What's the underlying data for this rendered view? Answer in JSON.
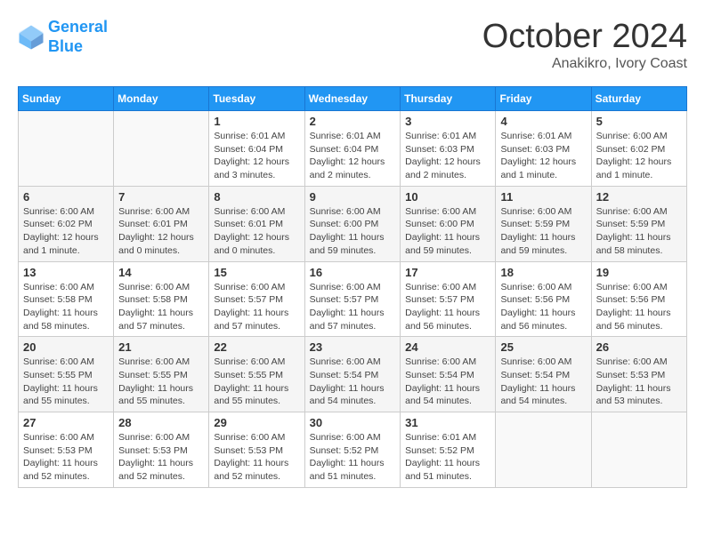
{
  "header": {
    "logo_line1": "General",
    "logo_line2": "Blue",
    "month": "October 2024",
    "location": "Anakikro, Ivory Coast"
  },
  "weekdays": [
    "Sunday",
    "Monday",
    "Tuesday",
    "Wednesday",
    "Thursday",
    "Friday",
    "Saturday"
  ],
  "weeks": [
    [
      {
        "day": "",
        "info": ""
      },
      {
        "day": "",
        "info": ""
      },
      {
        "day": "1",
        "info": "Sunrise: 6:01 AM\nSunset: 6:04 PM\nDaylight: 12 hours and 3 minutes."
      },
      {
        "day": "2",
        "info": "Sunrise: 6:01 AM\nSunset: 6:04 PM\nDaylight: 12 hours and 2 minutes."
      },
      {
        "day": "3",
        "info": "Sunrise: 6:01 AM\nSunset: 6:03 PM\nDaylight: 12 hours and 2 minutes."
      },
      {
        "day": "4",
        "info": "Sunrise: 6:01 AM\nSunset: 6:03 PM\nDaylight: 12 hours and 1 minute."
      },
      {
        "day": "5",
        "info": "Sunrise: 6:00 AM\nSunset: 6:02 PM\nDaylight: 12 hours and 1 minute."
      }
    ],
    [
      {
        "day": "6",
        "info": "Sunrise: 6:00 AM\nSunset: 6:02 PM\nDaylight: 12 hours and 1 minute."
      },
      {
        "day": "7",
        "info": "Sunrise: 6:00 AM\nSunset: 6:01 PM\nDaylight: 12 hours and 0 minutes."
      },
      {
        "day": "8",
        "info": "Sunrise: 6:00 AM\nSunset: 6:01 PM\nDaylight: 12 hours and 0 minutes."
      },
      {
        "day": "9",
        "info": "Sunrise: 6:00 AM\nSunset: 6:00 PM\nDaylight: 11 hours and 59 minutes."
      },
      {
        "day": "10",
        "info": "Sunrise: 6:00 AM\nSunset: 6:00 PM\nDaylight: 11 hours and 59 minutes."
      },
      {
        "day": "11",
        "info": "Sunrise: 6:00 AM\nSunset: 5:59 PM\nDaylight: 11 hours and 59 minutes."
      },
      {
        "day": "12",
        "info": "Sunrise: 6:00 AM\nSunset: 5:59 PM\nDaylight: 11 hours and 58 minutes."
      }
    ],
    [
      {
        "day": "13",
        "info": "Sunrise: 6:00 AM\nSunset: 5:58 PM\nDaylight: 11 hours and 58 minutes."
      },
      {
        "day": "14",
        "info": "Sunrise: 6:00 AM\nSunset: 5:58 PM\nDaylight: 11 hours and 57 minutes."
      },
      {
        "day": "15",
        "info": "Sunrise: 6:00 AM\nSunset: 5:57 PM\nDaylight: 11 hours and 57 minutes."
      },
      {
        "day": "16",
        "info": "Sunrise: 6:00 AM\nSunset: 5:57 PM\nDaylight: 11 hours and 57 minutes."
      },
      {
        "day": "17",
        "info": "Sunrise: 6:00 AM\nSunset: 5:57 PM\nDaylight: 11 hours and 56 minutes."
      },
      {
        "day": "18",
        "info": "Sunrise: 6:00 AM\nSunset: 5:56 PM\nDaylight: 11 hours and 56 minutes."
      },
      {
        "day": "19",
        "info": "Sunrise: 6:00 AM\nSunset: 5:56 PM\nDaylight: 11 hours and 56 minutes."
      }
    ],
    [
      {
        "day": "20",
        "info": "Sunrise: 6:00 AM\nSunset: 5:55 PM\nDaylight: 11 hours and 55 minutes."
      },
      {
        "day": "21",
        "info": "Sunrise: 6:00 AM\nSunset: 5:55 PM\nDaylight: 11 hours and 55 minutes."
      },
      {
        "day": "22",
        "info": "Sunrise: 6:00 AM\nSunset: 5:55 PM\nDaylight: 11 hours and 55 minutes."
      },
      {
        "day": "23",
        "info": "Sunrise: 6:00 AM\nSunset: 5:54 PM\nDaylight: 11 hours and 54 minutes."
      },
      {
        "day": "24",
        "info": "Sunrise: 6:00 AM\nSunset: 5:54 PM\nDaylight: 11 hours and 54 minutes."
      },
      {
        "day": "25",
        "info": "Sunrise: 6:00 AM\nSunset: 5:54 PM\nDaylight: 11 hours and 54 minutes."
      },
      {
        "day": "26",
        "info": "Sunrise: 6:00 AM\nSunset: 5:53 PM\nDaylight: 11 hours and 53 minutes."
      }
    ],
    [
      {
        "day": "27",
        "info": "Sunrise: 6:00 AM\nSunset: 5:53 PM\nDaylight: 11 hours and 52 minutes."
      },
      {
        "day": "28",
        "info": "Sunrise: 6:00 AM\nSunset: 5:53 PM\nDaylight: 11 hours and 52 minutes."
      },
      {
        "day": "29",
        "info": "Sunrise: 6:00 AM\nSunset: 5:53 PM\nDaylight: 11 hours and 52 minutes."
      },
      {
        "day": "30",
        "info": "Sunrise: 6:00 AM\nSunset: 5:52 PM\nDaylight: 11 hours and 51 minutes."
      },
      {
        "day": "31",
        "info": "Sunrise: 6:01 AM\nSunset: 5:52 PM\nDaylight: 11 hours and 51 minutes."
      },
      {
        "day": "",
        "info": ""
      },
      {
        "day": "",
        "info": ""
      }
    ]
  ]
}
